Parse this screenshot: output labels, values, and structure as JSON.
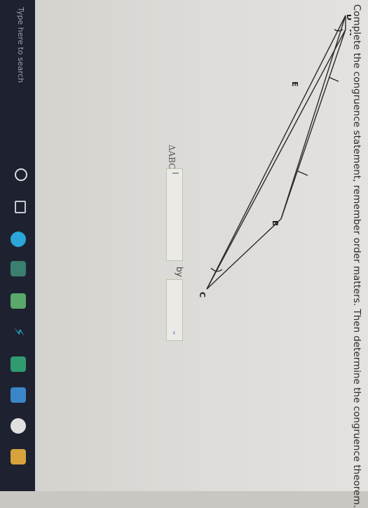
{
  "question": "Complete the congruence statement, remember order matters. Then determine the congruence theorem.",
  "figure": {
    "labels": {
      "D": "D",
      "A": "A",
      "E": "E",
      "B": "B",
      "C": "C"
    }
  },
  "statement": {
    "prefix": "ΔABC ≅ Δ",
    "input_value": "I",
    "by_label": "by",
    "select_value": ""
  },
  "taskbar": {
    "search_placeholder": "Type here to search",
    "icons": [
      "cortana-icon",
      "task-view-icon",
      "edge-icon",
      "store-icon",
      "photos-icon",
      "lightning-icon",
      "green-app-icon",
      "mail-icon",
      "chrome-icon",
      "files-icon"
    ]
  },
  "colors": {
    "accent": "#4a78b8",
    "taskbar": "#1e2230"
  }
}
